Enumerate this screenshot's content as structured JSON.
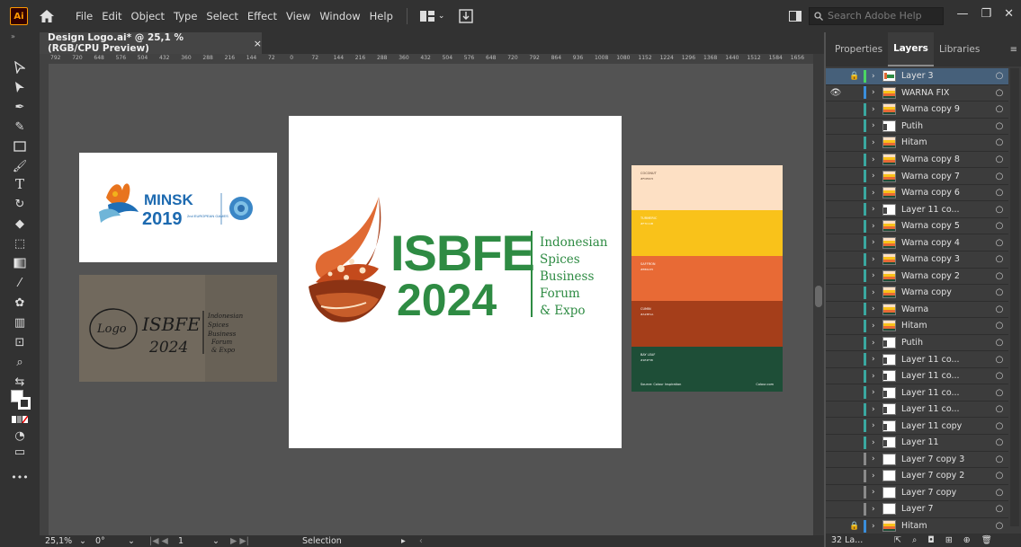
{
  "app": {
    "logo": "Ai",
    "menus": [
      "File",
      "Edit",
      "Object",
      "Type",
      "Select",
      "Effect",
      "View",
      "Window",
      "Help"
    ],
    "search_placeholder": "Search Adobe Help"
  },
  "document": {
    "tab_title": "Design Logo.ai* @ 25,1 % (RGB/CPU Preview)",
    "close": "×"
  },
  "ruler_ticks": [
    "792",
    "720",
    "648",
    "576",
    "504",
    "432",
    "360",
    "288",
    "216",
    "144",
    "72",
    "0",
    "72",
    "144",
    "216",
    "288",
    "360",
    "432",
    "504",
    "576",
    "648",
    "720",
    "792",
    "864",
    "936",
    "1008",
    "1080",
    "1152",
    "1224",
    "1296",
    "1368",
    "1440",
    "1512",
    "1584",
    "1656"
  ],
  "artboard": {
    "logo_word1": "ISBFE",
    "logo_word2": "2024",
    "tagline": [
      "Indonesian",
      "Spices",
      "Business",
      "Forum",
      "& Expo"
    ]
  },
  "reference": {
    "minsk_title": "MINSK",
    "minsk_year": "2019",
    "minsk_sub": "2nd EUROPEAN GAMES",
    "sketch_lines": [
      "Logo",
      "ISBFE",
      "2024",
      "Indonesian",
      "Spices",
      "Business",
      "Forum",
      "& Expo"
    ]
  },
  "palette": {
    "swatches": [
      {
        "color": "#fde0c4",
        "label": "COCONUT",
        "code": "#FCE0C5",
        "dark": true
      },
      {
        "color": "#f9c21a",
        "label": "TURMERIC",
        "code": "#F7C11B",
        "dark": false
      },
      {
        "color": "#e86a35",
        "label": "SAFFRON",
        "code": "#E86A35",
        "dark": false
      },
      {
        "color": "#a53e1a",
        "label": "CUMIN",
        "code": "#A23E1A",
        "dark": false
      },
      {
        "color": "#1e4e37",
        "label": "BAY LEAF",
        "code": "#1E4F38",
        "dark": false
      }
    ],
    "footer_left": "Source: Colour Inspiration",
    "footer_right": "Colour.com"
  },
  "statusbar": {
    "zoom": "25,1%",
    "rotation": "0°",
    "artboard_num": "1",
    "tool": "Selection"
  },
  "panel": {
    "tabs": [
      "Properties",
      "Layers",
      "Libraries"
    ],
    "active_tab": "Layers",
    "layer_count": "32 La...",
    "layers": [
      {
        "name": "Layer 3",
        "color": "#4bd663",
        "selected": true,
        "lock": true,
        "eye": false,
        "thumb": "logo"
      },
      {
        "name": "WARNA FIX",
        "color": "#3a8edb",
        "selected": false,
        "lock": false,
        "eye": true,
        "thumb": "palette"
      },
      {
        "name": "Warna copy 9",
        "color": "#3aa8a0",
        "selected": false,
        "lock": false,
        "eye": false,
        "thumb": "palette"
      },
      {
        "name": "Putih",
        "color": "#3aa8a0",
        "selected": false,
        "lock": false,
        "eye": false,
        "thumb": "sq"
      },
      {
        "name": "Hitam",
        "color": "#3aa8a0",
        "selected": false,
        "lock": false,
        "eye": false,
        "thumb": "palette"
      },
      {
        "name": "Warna copy 8",
        "color": "#3aa8a0",
        "selected": false,
        "lock": false,
        "eye": false,
        "thumb": "palette"
      },
      {
        "name": "Warna copy 7",
        "color": "#3aa8a0",
        "selected": false,
        "lock": false,
        "eye": false,
        "thumb": "palette"
      },
      {
        "name": "Warna copy 6",
        "color": "#3aa8a0",
        "selected": false,
        "lock": false,
        "eye": false,
        "thumb": "palette"
      },
      {
        "name": "Layer 11 co...",
        "color": "#3aa8a0",
        "selected": false,
        "lock": false,
        "eye": false,
        "thumb": "sq"
      },
      {
        "name": "Warna copy 5",
        "color": "#3aa8a0",
        "selected": false,
        "lock": false,
        "eye": false,
        "thumb": "palette"
      },
      {
        "name": "Warna copy 4",
        "color": "#3aa8a0",
        "selected": false,
        "lock": false,
        "eye": false,
        "thumb": "palette"
      },
      {
        "name": "Warna copy 3",
        "color": "#3aa8a0",
        "selected": false,
        "lock": false,
        "eye": false,
        "thumb": "palette"
      },
      {
        "name": "Warna copy 2",
        "color": "#3aa8a0",
        "selected": false,
        "lock": false,
        "eye": false,
        "thumb": "palette"
      },
      {
        "name": "Warna copy",
        "color": "#3aa8a0",
        "selected": false,
        "lock": false,
        "eye": false,
        "thumb": "palette"
      },
      {
        "name": "Warna",
        "color": "#3aa8a0",
        "selected": false,
        "lock": false,
        "eye": false,
        "thumb": "palette"
      },
      {
        "name": "Hitam",
        "color": "#3aa8a0",
        "selected": false,
        "lock": false,
        "eye": false,
        "thumb": "palette"
      },
      {
        "name": "Putih",
        "color": "#3aa8a0",
        "selected": false,
        "lock": false,
        "eye": false,
        "thumb": "sq"
      },
      {
        "name": "Layer 11 co...",
        "color": "#3aa8a0",
        "selected": false,
        "lock": false,
        "eye": false,
        "thumb": "sq"
      },
      {
        "name": "Layer 11 co...",
        "color": "#3aa8a0",
        "selected": false,
        "lock": false,
        "eye": false,
        "thumb": "sq"
      },
      {
        "name": "Layer 11 co...",
        "color": "#3aa8a0",
        "selected": false,
        "lock": false,
        "eye": false,
        "thumb": "sq"
      },
      {
        "name": "Layer 11 co...",
        "color": "#3aa8a0",
        "selected": false,
        "lock": false,
        "eye": false,
        "thumb": "sq"
      },
      {
        "name": "Layer 11 copy",
        "color": "#3aa8a0",
        "selected": false,
        "lock": false,
        "eye": false,
        "thumb": "sq"
      },
      {
        "name": "Layer 11",
        "color": "#3aa8a0",
        "selected": false,
        "lock": false,
        "eye": false,
        "thumb": "sq"
      },
      {
        "name": "Layer 7 copy 3",
        "color": "#8a8a8a",
        "selected": false,
        "lock": false,
        "eye": false,
        "thumb": "white"
      },
      {
        "name": "Layer 7 copy 2",
        "color": "#8a8a8a",
        "selected": false,
        "lock": false,
        "eye": false,
        "thumb": "white"
      },
      {
        "name": "Layer 7 copy",
        "color": "#8a8a8a",
        "selected": false,
        "lock": false,
        "eye": false,
        "thumb": "white"
      },
      {
        "name": "Layer 7",
        "color": "#8a8a8a",
        "selected": false,
        "lock": false,
        "eye": false,
        "thumb": "white"
      },
      {
        "name": "Hitam",
        "color": "#3a8edb",
        "selected": false,
        "lock": true,
        "eye": false,
        "thumb": "palette"
      }
    ]
  }
}
